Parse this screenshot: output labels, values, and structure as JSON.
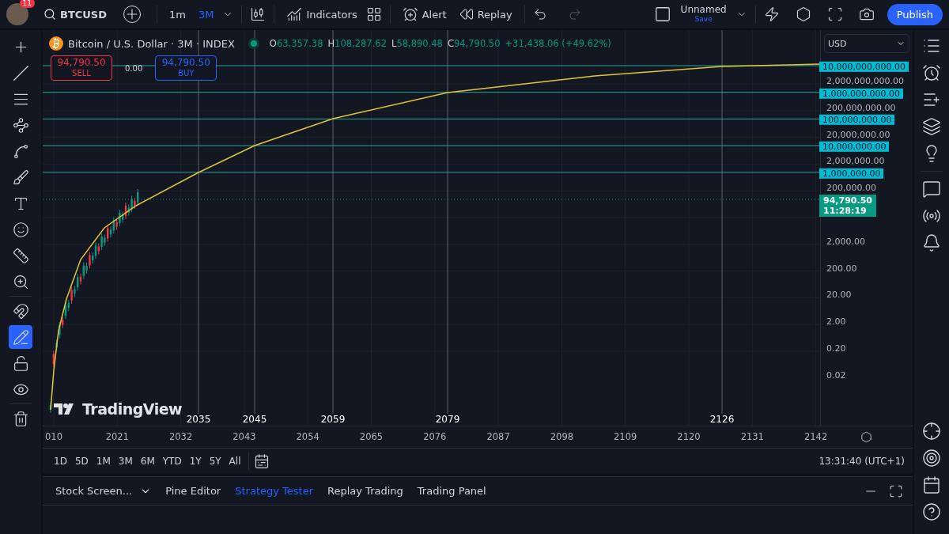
{
  "header": {
    "notifications": "11",
    "symbol": "BTCUSD",
    "intervals": [
      {
        "label": "1m",
        "selected": false
      },
      {
        "label": "3M",
        "selected": true
      }
    ],
    "indicators": "Indicators",
    "alert": "Alert",
    "replay": "Replay",
    "layout_name": "Unnamed",
    "layout_status": "Save",
    "publish": "Publish"
  },
  "left_tools": [
    {
      "kind": "crosshair",
      "selected": false
    },
    {
      "kind": "line",
      "selected": false
    },
    {
      "kind": "lines",
      "selected": false
    },
    {
      "kind": "pattern",
      "selected": false
    },
    {
      "kind": "fib",
      "selected": false
    },
    {
      "kind": "brush",
      "selected": false
    },
    {
      "kind": "text",
      "selected": false
    },
    {
      "kind": "smile",
      "selected": false
    },
    {
      "kind": "ruler",
      "selected": false
    },
    {
      "kind": "zoom",
      "selected": false
    },
    {
      "kind": "magnet",
      "selected": false
    },
    {
      "kind": "pencil",
      "selected": true
    },
    {
      "kind": "lock",
      "selected": false
    },
    {
      "kind": "eye",
      "selected": false
    },
    {
      "kind": "trash",
      "selected": false
    }
  ],
  "legend": {
    "title": "Bitcoin / U.S. Dollar · 3M · INDEX",
    "ohlc": [
      {
        "key": "O",
        "value": "63,357.38"
      },
      {
        "key": "H",
        "value": "108,287.62"
      },
      {
        "key": "L",
        "value": "58,890.48"
      },
      {
        "key": "C",
        "value": "94,790.50"
      }
    ],
    "change": "+31,438.06 (+49.62%)"
  },
  "trade": {
    "sell_price": "94,790.50",
    "sell": "SELL",
    "spread": "0.00",
    "buy_price": "94,790.50",
    "buy": "BUY"
  },
  "currency": "USD",
  "price_axis": [
    "2,000,000,000.00",
    "200,000,000.00",
    "20,000,000.00",
    "2,000,000.00",
    "200,000.00",
    "2,000.00",
    "200.00",
    "20.00",
    "2.00",
    "0.20",
    "0.02"
  ],
  "levels": [
    "10,000,000,000.00",
    "1,000,000,000.00",
    "100,000,000.00",
    "10,000,000.00",
    "1,000,000.00"
  ],
  "last_price": {
    "price": "94,790.50",
    "countdown": "11:28:19"
  },
  "year_markers": [
    "2035",
    "2045",
    "2059",
    "2079",
    "2126"
  ],
  "time_axis": [
    "010",
    "2021",
    "2032",
    "2043",
    "2054",
    "2065",
    "2076",
    "2087",
    "2098",
    "2109",
    "2120",
    "2131",
    "2142"
  ],
  "watermark": "TradingView",
  "ranges": [
    "1D",
    "5D",
    "1M",
    "3M",
    "6M",
    "YTD",
    "1Y",
    "5Y",
    "All"
  ],
  "clock": "13:31:40 (UTC+1)",
  "bottom_tabs": [
    {
      "label": "Stock Screen...",
      "selected": false,
      "kind": "menu"
    },
    {
      "label": "Pine Editor",
      "selected": false,
      "kind": "tab"
    },
    {
      "label": "Strategy Tester",
      "selected": true,
      "kind": "tab"
    },
    {
      "label": "Replay Trading",
      "selected": false,
      "kind": "tab"
    },
    {
      "label": "Trading Panel",
      "selected": false,
      "kind": "tab"
    }
  ]
}
